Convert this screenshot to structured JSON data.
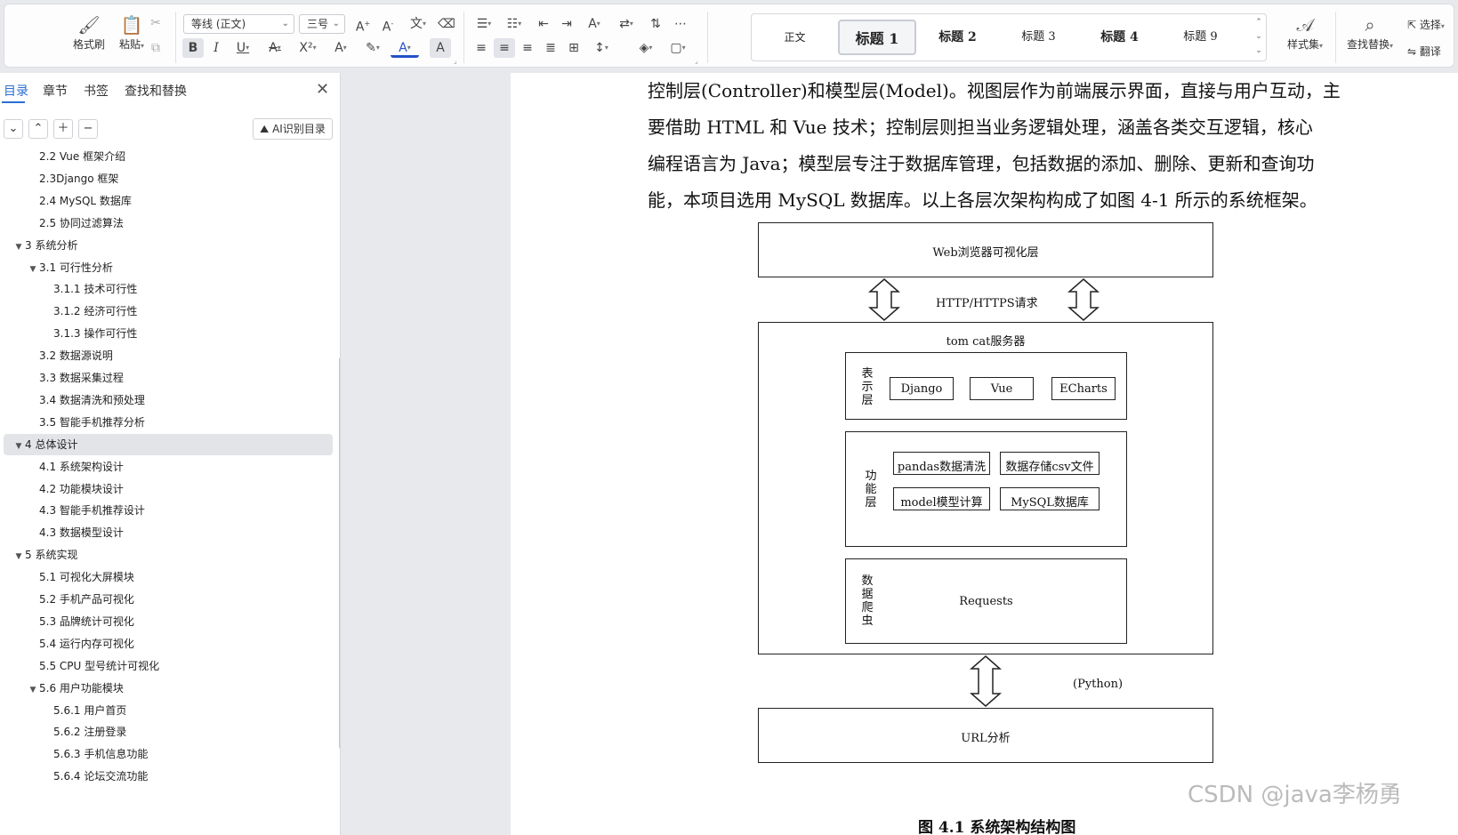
{
  "ribbon": {
    "clipboard": {
      "format_painter": "格式刷",
      "paste": "粘贴"
    },
    "font": {
      "name": "等线 (正文)",
      "size": "三号"
    },
    "styles": [
      {
        "label": "正文",
        "selected": false
      },
      {
        "label": "标题 1",
        "selected": true
      },
      {
        "label": "标题 2",
        "selected": false
      },
      {
        "label": "标题 3",
        "selected": false
      },
      {
        "label": "标题 4",
        "selected": false
      },
      {
        "label": "标题 9",
        "selected": false
      }
    ],
    "style_set": "样式集",
    "find_replace": "查找替换",
    "select": "选择",
    "translate": "翻译"
  },
  "nav": {
    "tabs": [
      "目录",
      "章节",
      "书签",
      "查找和替换"
    ],
    "active_tab": "目录",
    "ai_toc_label": "AI识别目录",
    "toc": [
      {
        "label": "2.2 Vue 框架介绍",
        "level": 2,
        "expander": "",
        "selected": false
      },
      {
        "label": "2.3Django 框架",
        "level": 2,
        "expander": "",
        "selected": false
      },
      {
        "label": "2.4 MySQL 数据库",
        "level": 2,
        "expander": "",
        "selected": false
      },
      {
        "label": "2.5 协同过滤算法",
        "level": 2,
        "expander": "",
        "selected": false
      },
      {
        "label": "3 系统分析",
        "level": 1,
        "expander": "▼",
        "selected": false
      },
      {
        "label": "3.1  可行性分析",
        "level": 2,
        "expander": "▼",
        "selected": false
      },
      {
        "label": "3.1.1  技术可行性",
        "level": 3,
        "expander": "",
        "selected": false
      },
      {
        "label": "3.1.2  经济可行性",
        "level": 3,
        "expander": "",
        "selected": false
      },
      {
        "label": "3.1.3  操作可行性",
        "level": 3,
        "expander": "",
        "selected": false
      },
      {
        "label": "3.2 数据源说明",
        "level": 2,
        "expander": "",
        "selected": false
      },
      {
        "label": "3.3 数据采集过程",
        "level": 2,
        "expander": "",
        "selected": false
      },
      {
        "label": "3.4 数据清洗和预处理",
        "level": 2,
        "expander": "",
        "selected": false
      },
      {
        "label": "3.5 智能手机推荐分析",
        "level": 2,
        "expander": "",
        "selected": false
      },
      {
        "label": "4 总体设计",
        "level": 1,
        "expander": "▼",
        "selected": true
      },
      {
        "label": "4.1 系统架构设计",
        "level": 2,
        "expander": "",
        "selected": false
      },
      {
        "label": "4.2 功能模块设计",
        "level": 2,
        "expander": "",
        "selected": false
      },
      {
        "label": "4.3 智能手机推荐设计",
        "level": 2,
        "expander": "",
        "selected": false
      },
      {
        "label": "4.3 数据模型设计",
        "level": 2,
        "expander": "",
        "selected": false
      },
      {
        "label": "5 系统实现",
        "level": 1,
        "expander": "▼",
        "selected": false
      },
      {
        "label": "5.1  可视化大屏模块",
        "level": 2,
        "expander": "",
        "selected": false
      },
      {
        "label": "5.2  手机产品可视化",
        "level": 2,
        "expander": "",
        "selected": false
      },
      {
        "label": "5.3  品牌统计可视化",
        "level": 2,
        "expander": "",
        "selected": false
      },
      {
        "label": "5.4  运行内存可视化",
        "level": 2,
        "expander": "",
        "selected": false
      },
      {
        "label": "5.5 CPU 型号统计可视化",
        "level": 2,
        "expander": "",
        "selected": false
      },
      {
        "label": "5.6  用户功能模块",
        "level": 2,
        "expander": "▼",
        "selected": false
      },
      {
        "label": "5.6.1 用户首页",
        "level": 3,
        "expander": "",
        "selected": false
      },
      {
        "label": "5.6.2 注册登录",
        "level": 3,
        "expander": "",
        "selected": false
      },
      {
        "label": "5.6.3 手机信息功能",
        "level": 3,
        "expander": "",
        "selected": false
      },
      {
        "label": "5.6.4 论坛交流功能",
        "level": 3,
        "expander": "",
        "selected": false
      }
    ]
  },
  "document": {
    "lines": [
      "控制层(Controller)和模型层(Model)。视图层作为前端展示界面，直接与用户互动，主",
      "要借助 HTML 和 Vue 技术；控制层则担当业务逻辑处理，涵盖各类交互逻辑，核心",
      "编程语言为 Java；模型层专注于数据库管理，包括数据的添加、删除、更新和查询功",
      "能，本项目选用 MySQL 数据库。以上各层次架构构成了如图 4-1 所示的系统框架。"
    ],
    "diagram": {
      "top_box": "Web浏览器可视化层",
      "http_label": "HTTP/HTTPS请求",
      "server_title": "tom cat服务器",
      "presentation_label": "表示层",
      "presentation_items": [
        "Django",
        "Vue",
        "ECharts"
      ],
      "function_label": "功能层",
      "function_items": [
        "pandas数据清洗",
        "数据存储csv文件",
        "model模型计算",
        "MySQL数据库"
      ],
      "crawler_label": "数据爬虫",
      "crawler_item": "Requests",
      "python_label": "(Python)",
      "bottom_box": "URL分析"
    },
    "caption": "图 4.1 系统架构结构图"
  },
  "watermark": "CSDN @java李杨勇"
}
